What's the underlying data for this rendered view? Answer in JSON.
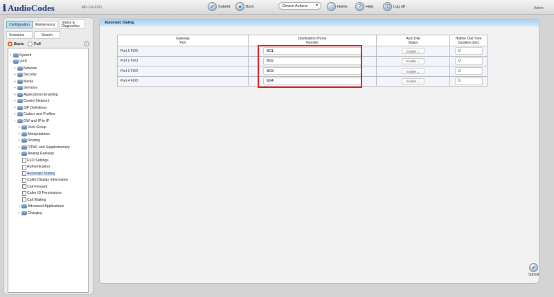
{
  "header": {
    "brand": "AudioCodes",
    "device": "MP-114 FXO",
    "submit": "Submit",
    "burn": "Burn",
    "device_actions": "Device Actions",
    "home": "Home",
    "help": "Help",
    "logoff": "Log off",
    "user": "Admin"
  },
  "left": {
    "tabs": {
      "configuration": "Configuration",
      "maintenance": "Maintenance",
      "status": "Status & Diagnostics",
      "scenarios": "Scenarios",
      "search": "Search"
    },
    "view_basic": "Basic",
    "view_full": "Full",
    "tree": [
      {
        "label": "System",
        "type": "folder",
        "level": 0,
        "pm": "+"
      },
      {
        "label": "VoIP",
        "type": "folder",
        "level": 0,
        "pm": "−"
      },
      {
        "label": "Network",
        "type": "folder",
        "level": 1,
        "pm": "+"
      },
      {
        "label": "Security",
        "type": "folder",
        "level": 1,
        "pm": "+"
      },
      {
        "label": "Media",
        "type": "folder",
        "level": 1,
        "pm": "+"
      },
      {
        "label": "Services",
        "type": "folder",
        "level": 1,
        "pm": "+"
      },
      {
        "label": "Applications Enabling",
        "type": "folder",
        "level": 1,
        "pm": "+"
      },
      {
        "label": "Control Network",
        "type": "folder",
        "level": 1,
        "pm": "+"
      },
      {
        "label": "SIP Definitions",
        "type": "folder",
        "level": 1,
        "pm": "+"
      },
      {
        "label": "Coders and Profiles",
        "type": "folder",
        "level": 1,
        "pm": "+"
      },
      {
        "label": "GW and IP to IP",
        "type": "folder",
        "level": 1,
        "pm": "−"
      },
      {
        "label": "Hunt Group",
        "type": "folder",
        "level": 2,
        "pm": "+"
      },
      {
        "label": "Manipulations",
        "type": "folder",
        "level": 2,
        "pm": "+"
      },
      {
        "label": "Routing",
        "type": "folder",
        "level": 2,
        "pm": "+"
      },
      {
        "label": "DTMF and Supplementary",
        "type": "folder",
        "level": 2,
        "pm": "+"
      },
      {
        "label": "Analog Gateway",
        "type": "folder",
        "level": 2,
        "pm": "−"
      },
      {
        "label": "FXO Settings",
        "type": "page",
        "level": 3
      },
      {
        "label": "Authentication",
        "type": "page",
        "level": 3
      },
      {
        "label": "Automatic Dialing",
        "type": "page",
        "level": 3,
        "selected": true
      },
      {
        "label": "Caller Display Information",
        "type": "page",
        "level": 3
      },
      {
        "label": "Call Forward",
        "type": "page",
        "level": 3
      },
      {
        "label": "Caller ID Permissions",
        "type": "page",
        "level": 3
      },
      {
        "label": "Call Waiting",
        "type": "page",
        "level": 3
      },
      {
        "label": "Advanced Applications",
        "type": "folder",
        "level": 2,
        "pm": "+"
      },
      {
        "label": "Charging",
        "type": "folder",
        "level": 2,
        "pm": "+"
      }
    ]
  },
  "main": {
    "title": "Automatic Dialing",
    "columns": [
      [
        "Gateway",
        "Port"
      ],
      [
        "Destination Phone",
        "Number"
      ],
      [
        "Auto Dial",
        "Status"
      ],
      [
        "Hotline Dial Tone",
        "Duration [sec]"
      ]
    ],
    "rows": [
      {
        "port": "Port 1  FXO",
        "number": "601",
        "status": "Enable",
        "duration": "0"
      },
      {
        "port": "Port 2  FXO",
        "number": "602",
        "status": "Enable",
        "duration": "0"
      },
      {
        "port": "Port 3  FXO",
        "number": "603",
        "status": "Enable",
        "duration": "0"
      },
      {
        "port": "Port 4  FXO",
        "number": "604",
        "status": "Enable",
        "duration": "0"
      }
    ],
    "submit": "Submit",
    "highlight_color": "#e5161b"
  }
}
